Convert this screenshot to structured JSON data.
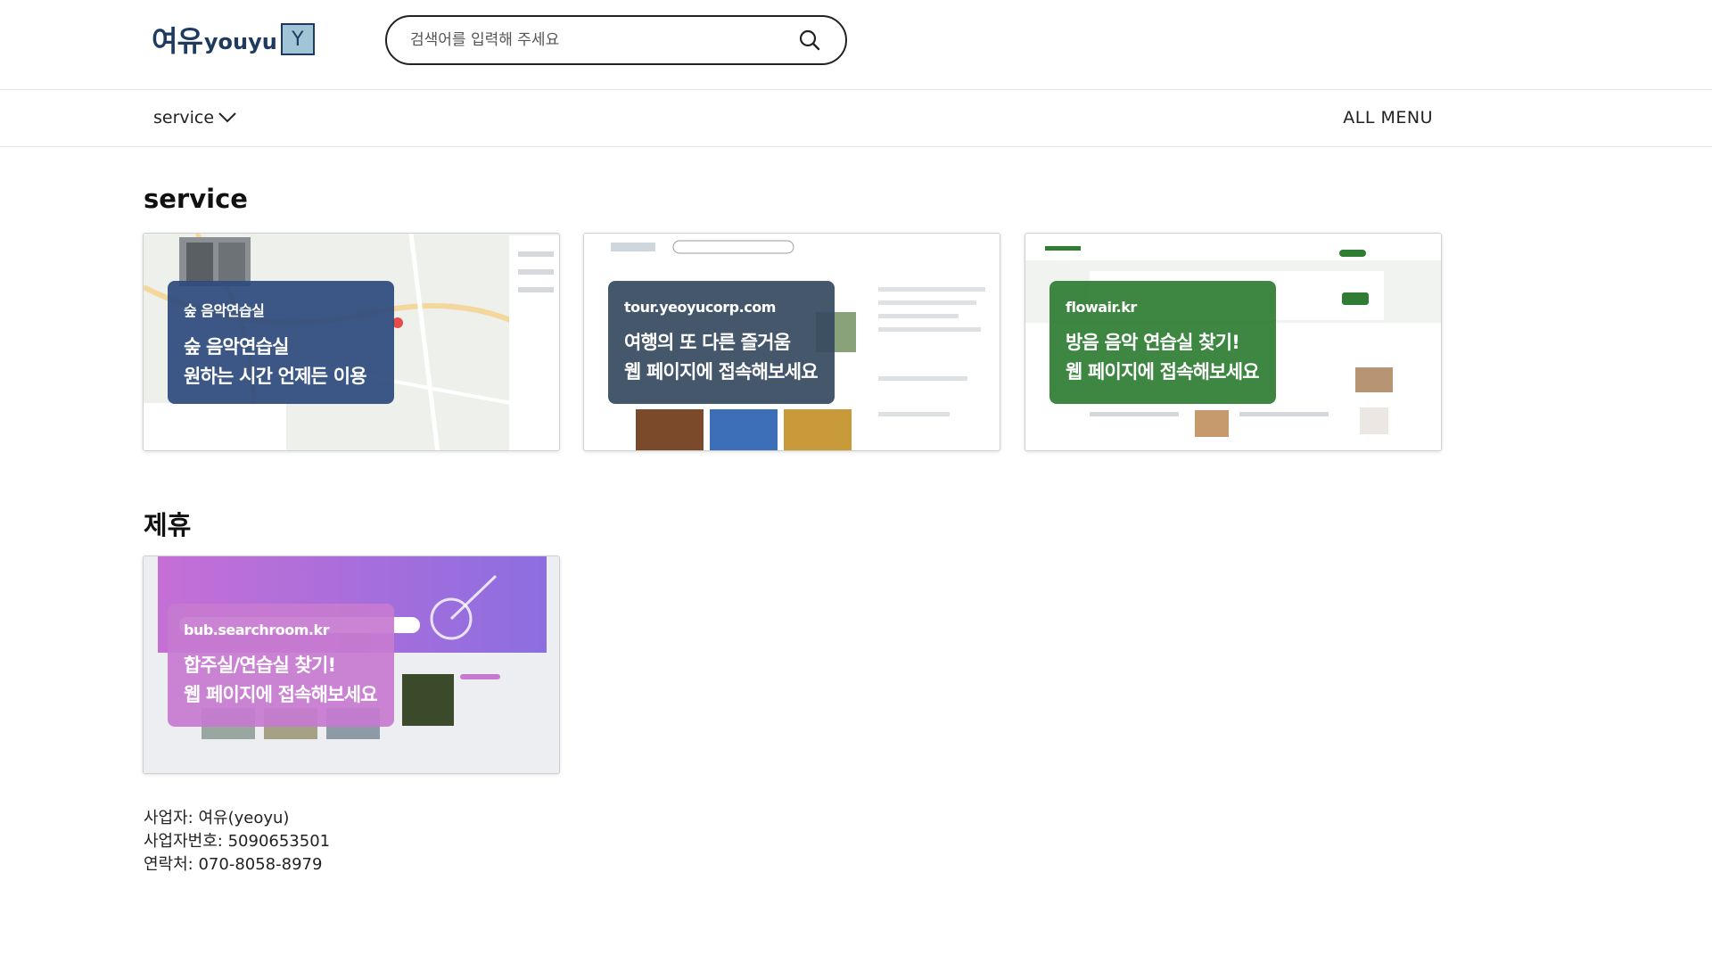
{
  "header": {
    "logo_kr": "여유",
    "logo_en": "youyu",
    "logo_box": "Y",
    "search_placeholder": "검색어를 입력해 주세요"
  },
  "nav": {
    "service_label": "service",
    "all_menu_label": "ALL MENU"
  },
  "sections": {
    "service": {
      "title": "service",
      "cards": [
        {
          "sub": "숲 음악연습실",
          "main": "숲 음악연습실\n원하는 시간 언제든 이용",
          "color": "#2c4a7c"
        },
        {
          "sub": "tour.yeoyucorp.com",
          "main": "여행의 또 다른 즐거움\n웹 페이지에 접속해보세요",
          "color": "#34495e"
        },
        {
          "sub": "flowair.kr",
          "main": "방음 음악 연습실 찾기!\n웹 페이지에 접속해보세요",
          "color": "#2e7d32"
        }
      ]
    },
    "partner": {
      "title": "제휴",
      "cards": [
        {
          "sub": "bub.searchroom.kr",
          "main": "합주실/연습실 찾기!\n웹 페이지에 접속해보세요",
          "color": "#c779d0"
        }
      ]
    }
  },
  "footer": {
    "business": "사업자: 여유(yeoyu)",
    "business_number": "사업자번호: 5090653501",
    "contact": "연락처: 070-8058-8979"
  }
}
